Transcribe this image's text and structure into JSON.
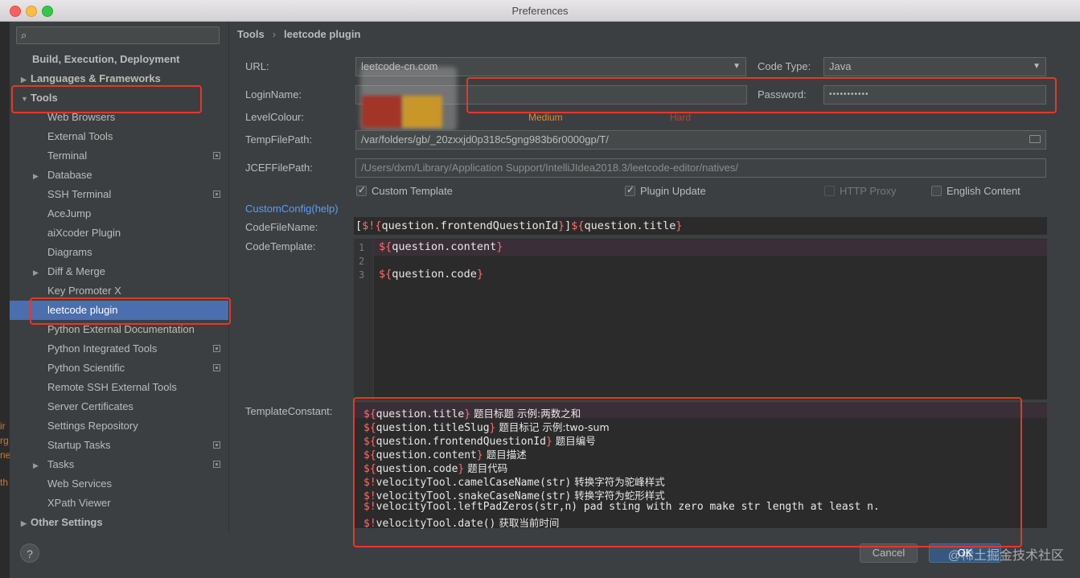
{
  "window": {
    "title": "Preferences"
  },
  "sidebar": {
    "search_placeholder": "",
    "items": [
      {
        "label": "Build, Execution, Deployment",
        "arrow": ""
      },
      {
        "label": "Languages & Frameworks",
        "arrow": "▶"
      },
      {
        "label": "Tools",
        "arrow": "▼"
      },
      {
        "label": "Web Browsers",
        "arrow": ""
      },
      {
        "label": "External Tools",
        "arrow": ""
      },
      {
        "label": "Terminal",
        "arrow": ""
      },
      {
        "label": "Database",
        "arrow": "▶"
      },
      {
        "label": "SSH Terminal",
        "arrow": ""
      },
      {
        "label": "AceJump",
        "arrow": ""
      },
      {
        "label": "aiXcoder Plugin",
        "arrow": ""
      },
      {
        "label": "Diagrams",
        "arrow": ""
      },
      {
        "label": "Diff & Merge",
        "arrow": "▶"
      },
      {
        "label": "Key Promoter X",
        "arrow": ""
      },
      {
        "label": "leetcode plugin",
        "arrow": ""
      },
      {
        "label": "Python External Documentation",
        "arrow": ""
      },
      {
        "label": "Python Integrated Tools",
        "arrow": ""
      },
      {
        "label": "Python Scientific",
        "arrow": ""
      },
      {
        "label": "Remote SSH External Tools",
        "arrow": ""
      },
      {
        "label": "Server Certificates",
        "arrow": ""
      },
      {
        "label": "Settings Repository",
        "arrow": ""
      },
      {
        "label": "Startup Tasks",
        "arrow": ""
      },
      {
        "label": "Tasks",
        "arrow": "▶"
      },
      {
        "label": "Web Services",
        "arrow": ""
      },
      {
        "label": "XPath Viewer",
        "arrow": ""
      },
      {
        "label": "Other Settings",
        "arrow": "▶"
      }
    ]
  },
  "breadcrumb": {
    "parent": "Tools",
    "separator": "›",
    "current": "leetcode plugin"
  },
  "form": {
    "url_label": "URL:",
    "url_value": "leetcode-cn.com",
    "code_type_label": "Code Type:",
    "code_type_value": "Java",
    "login_label": "LoginName:",
    "login_value": "",
    "password_label": "Password:",
    "password_value": "•••••••••••",
    "level_label": "LevelColour:",
    "level_medium": "Medium",
    "level_hard": "Hard",
    "temp_label": "TempFilePath:",
    "temp_value": "/var/folders/gb/_20zxxjd0p318c5gng983b6r0000gp/T/",
    "jcef_label": "JCEFFilePath:",
    "jcef_value": "/Users/dxm/Library/Application Support/IntelliJIdea2018.3/leetcode-editor/natives/",
    "custom_template": "Custom Template",
    "plugin_update": "Plugin Update",
    "http_proxy": "HTTP Proxy",
    "english_content": "English Content",
    "custom_config_link": "CustomConfig(help)",
    "code_file_name_label": "CodeFileName:",
    "code_file_name": {
      "p1": "[",
      "p2": "$!{",
      "p3": "question.frontendQuestionId",
      "p4": "}",
      "p5": "]",
      "p6": "${",
      "p7": "question.title",
      "p8": "}"
    },
    "code_template_label": "CodeTemplate:",
    "template_constant_label": "TemplateConstant:"
  },
  "editor": {
    "line_numbers": [
      "1",
      "2",
      "3"
    ],
    "lines": [
      {
        "open": "${",
        "body": "question.content",
        "close": "}"
      },
      {
        "open": "",
        "body": "",
        "close": ""
      },
      {
        "open": "${",
        "body": "question.code",
        "close": "}"
      }
    ]
  },
  "constants": [
    {
      "open": "${",
      "body": "question.title",
      "close": "}",
      "desc": "  题目标题 示例:两数之和"
    },
    {
      "open": "${",
      "body": "question.titleSlug",
      "close": "}",
      "desc": "  题目标记 示例:two-sum"
    },
    {
      "open": "${",
      "body": "question.frontendQuestionId",
      "close": "}",
      "desc": " 题目编号"
    },
    {
      "open": "${",
      "body": "question.content",
      "close": "}",
      "desc": " 题目描述"
    },
    {
      "open": "${",
      "body": "question.code",
      "close": "}",
      "desc": "   题目代码"
    },
    {
      "open": "$!",
      "body": "velocityTool.camelCaseName(str)",
      "close": "",
      "desc": "  转换字符为驼峰样式"
    },
    {
      "open": "$!",
      "body": "velocityTool.snakeCaseName(str)",
      "close": "",
      "desc": "  转换字符为蛇形样式"
    },
    {
      "open": "$!",
      "body": "velocityTool.leftPadZeros(str,n)",
      "close": "",
      "desc": "  pad sting with zero make str length at least n."
    },
    {
      "open": "$!",
      "body": "velocityTool.date()",
      "close": "",
      "desc": "  获取当前时间"
    }
  ],
  "buttons": {
    "cancel": "Cancel",
    "ok": "OK",
    "help": "?"
  },
  "watermark": "@稀土掘金技术社区",
  "left_edge_fragments": [
    "ir",
    "rg",
    "ne",
    "th"
  ],
  "colors": {
    "accent": "#4b6eaf",
    "annotation": "#e6372a",
    "template_var": "#ff6b6b"
  }
}
